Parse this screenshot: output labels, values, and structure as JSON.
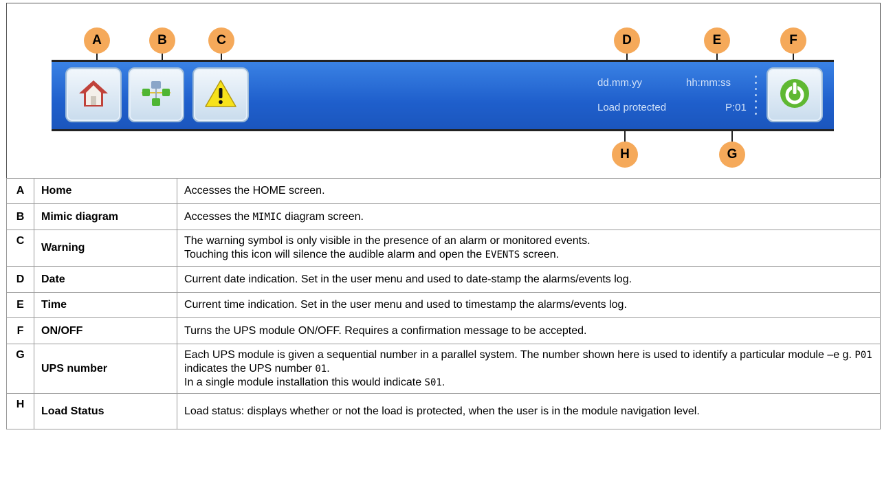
{
  "callouts": {
    "a": "A",
    "b": "B",
    "c": "C",
    "d": "D",
    "e": "E",
    "f": "F",
    "g": "G",
    "h": "H"
  },
  "status_bar": {
    "date": "dd.mm.yy",
    "time": "hh:mm:ss",
    "load_status": "Load protected",
    "ups_number": "P:01"
  },
  "icons": {
    "home": "home-icon",
    "mimic": "mimic-diagram-icon",
    "warning": "warning-icon",
    "power": "power-icon"
  },
  "colors": {
    "bar": "#1f5fcc",
    "callout": "#f5a95a",
    "warning": "#f7e21b",
    "power": "#5fb832"
  },
  "table": {
    "rows": [
      {
        "key": "A",
        "name": "Home",
        "desc": [
          {
            "t": "Accesses the HOME screen."
          }
        ]
      },
      {
        "key": "B",
        "name": "Mimic diagram",
        "desc": [
          {
            "t": "Accesses the "
          },
          {
            "m": "MIMIC"
          },
          {
            "t": " diagram screen."
          }
        ]
      },
      {
        "key": "C",
        "name": "Warning",
        "desc": [
          {
            "t": "The warning symbol is only visible in the presence of an alarm or monitored events."
          },
          {
            "br": true
          },
          {
            "t": "Touching this icon will silence the audible alarm and open the "
          },
          {
            "m": "EVENTS"
          },
          {
            "t": " screen."
          }
        ]
      },
      {
        "key": "D",
        "name": "Date",
        "desc": [
          {
            "t": "Current date indication. Set in the user menu and used to date-stamp the alarms/events log."
          }
        ]
      },
      {
        "key": "E",
        "name": "Time",
        "desc": [
          {
            "t": "Current time indication. Set in the user menu and used to timestamp the alarms/events log."
          }
        ]
      },
      {
        "key": "F",
        "name": "ON/OFF",
        "desc": [
          {
            "t": "Turns the UPS module ON/OFF. Requires a confirmation message to be accepted."
          }
        ]
      },
      {
        "key": "G",
        "name": "UPS number",
        "desc": [
          {
            "t": "Each UPS module is given a sequential number in a parallel system. The number shown here is used to identify a particular module –e g. "
          },
          {
            "m": "P01"
          },
          {
            "t": " indicates the UPS number "
          },
          {
            "m": "01"
          },
          {
            "t": "."
          },
          {
            "br": true
          },
          {
            "t": "In a single module installation this would indicate "
          },
          {
            "m": "S01"
          },
          {
            "t": "."
          }
        ]
      },
      {
        "key": "H",
        "name": "Load Status",
        "desc": [
          {
            "t": "Load status: displays whether or not the load is protected, when the user is in the module navigation level."
          }
        ]
      }
    ]
  }
}
